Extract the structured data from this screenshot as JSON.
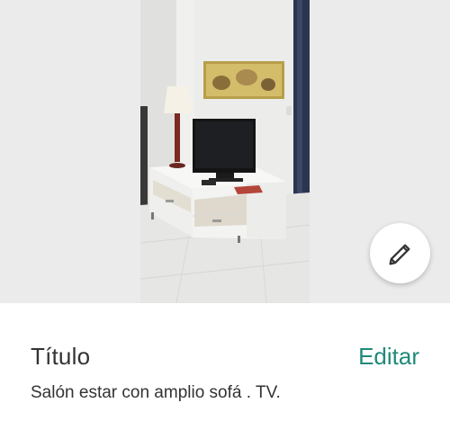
{
  "photo": {
    "edit_icon": "pencil-icon"
  },
  "title_section": {
    "label": "Título",
    "edit_label": "Editar",
    "value": "Salón estar con amplio sofá . TV."
  },
  "colors": {
    "accent": "#1f8a7a",
    "text": "#333333",
    "photo_background": "#ebebeb"
  }
}
